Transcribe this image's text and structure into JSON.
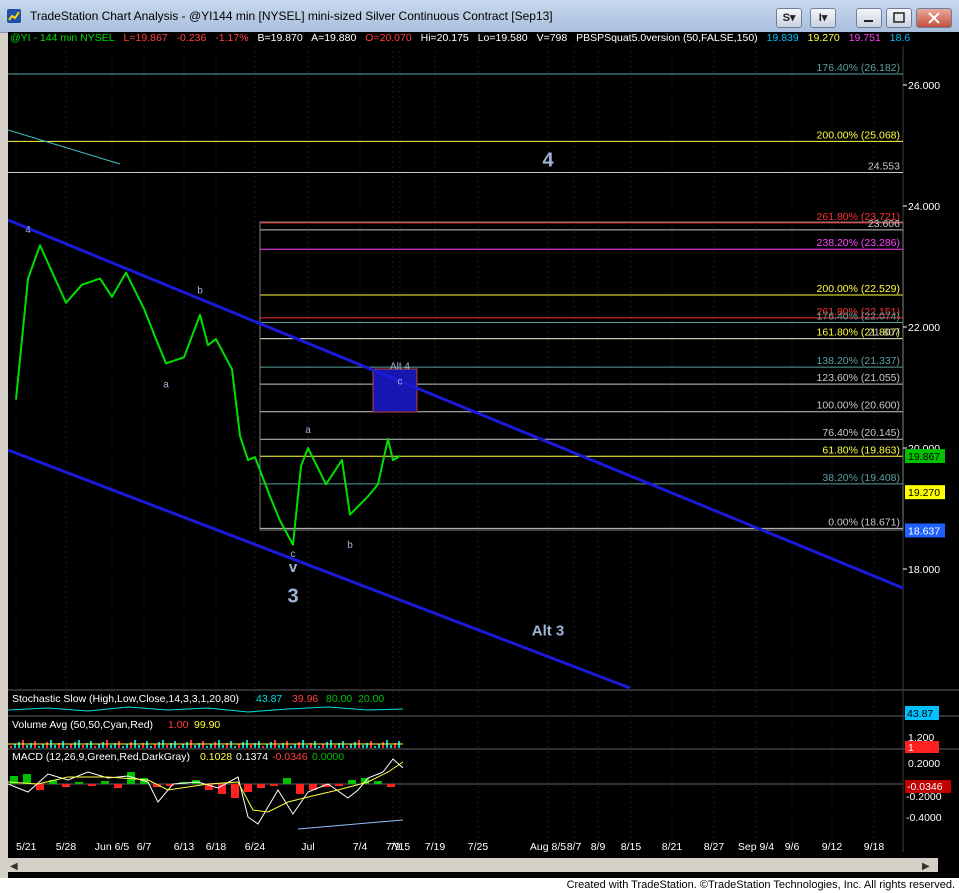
{
  "window": {
    "title": "TradeStation Chart Analysis - @YI144 min [NYSEL] mini-sized Silver Continuous Contract [Sep13]",
    "buttons": [
      "S",
      "I"
    ]
  },
  "infobar": {
    "symbol": "@YI - 144 min  NYSEL",
    "last": "L=19.867",
    "change": "-0.236",
    "change_pct": "-1.17%",
    "bid": "B=19.870",
    "ask": "A=19.880",
    "open": "O=20.070",
    "hi": "Hi=20.175",
    "lo": "Lo=19.580",
    "volume": "V=798",
    "study": "PBSPSquat5.0version (50,FALSE,150)",
    "study_vals": [
      "19.839",
      "19.270",
      "19.751",
      "18.6"
    ]
  },
  "colors": {
    "background": "#000000",
    "price": "#00e000",
    "channel": "#1a1ad8",
    "fib_line": "#c8c8c8",
    "red_line": "#ff3030",
    "magenta_line": "#ff40ff",
    "yellow_line": "#ffff40",
    "alt4_box": "#1616b0",
    "label_blue": "#9fb4d8"
  },
  "chart_data": {
    "type": "line",
    "title": "",
    "xlabel": "",
    "ylabel": "",
    "ylim": [
      16.8,
      26.8
    ],
    "yticks": [
      "26.000",
      "24.000",
      "22.000",
      "20.000",
      "18.000"
    ],
    "xticks": [
      "5/21",
      "5/28",
      "Jun 6/5",
      "6/7",
      "6/13",
      "6/18",
      "6/24",
      "Jul",
      "7/4",
      "7/9",
      "7/15",
      "7/19",
      "7/25",
      "Aug 8/5",
      "8/7",
      "8/9",
      "8/15",
      "8/21",
      "8/27",
      "Sep 9/4",
      "9/6",
      "9/12",
      "9/18"
    ],
    "price_series": [
      {
        "x": "5/21",
        "y": 20.8
      },
      {
        "x": "5/23",
        "y": 22.8
      },
      {
        "x": "5/25",
        "y": 23.35
      },
      {
        "x": "5/28",
        "y": 22.4
      },
      {
        "x": "5/30",
        "y": 22.7
      },
      {
        "x": "6/3",
        "y": 22.8
      },
      {
        "x": "6/5",
        "y": 22.5
      },
      {
        "x": "6/6",
        "y": 22.9
      },
      {
        "x": "6/7",
        "y": 22.3
      },
      {
        "x": "6/10",
        "y": 21.8
      },
      {
        "x": "6/11",
        "y": 21.4
      },
      {
        "x": "6/13",
        "y": 21.5
      },
      {
        "x": "6/14",
        "y": 22.2
      },
      {
        "x": "6/17",
        "y": 21.7
      },
      {
        "x": "6/18",
        "y": 21.8
      },
      {
        "x": "6/19",
        "y": 21.3
      },
      {
        "x": "6/20",
        "y": 20.2
      },
      {
        "x": "6/21",
        "y": 19.8
      },
      {
        "x": "6/24",
        "y": 19.85
      },
      {
        "x": "6/25",
        "y": 19.2
      },
      {
        "x": "6/26",
        "y": 18.8
      },
      {
        "x": "6/27",
        "y": 18.4
      },
      {
        "x": "6/28",
        "y": 19.7
      },
      {
        "x": "7/1",
        "y": 20.0
      },
      {
        "x": "7/2",
        "y": 19.4
      },
      {
        "x": "7/3",
        "y": 19.8
      },
      {
        "x": "7/5",
        "y": 18.9
      },
      {
        "x": "7/8",
        "y": 19.2
      },
      {
        "x": "7/9",
        "y": 19.4
      },
      {
        "x": "7/10",
        "y": 20.15
      },
      {
        "x": "7/11",
        "y": 19.8
      },
      {
        "x": "7/12",
        "y": 19.87
      }
    ],
    "fib_levels": [
      {
        "label": "176.40% (26.182)",
        "value": 26.182,
        "color": "#5aa0a0"
      },
      {
        "label": "200.00% (25.068)",
        "value": 25.068,
        "color": "#ffff40"
      },
      {
        "label": "24.553",
        "value": 24.553,
        "color": "#c8c8c8"
      },
      {
        "label": "261.80% (23.721)",
        "value": 23.721,
        "color": "#ff3030"
      },
      {
        "label": "23.606",
        "value": 23.606,
        "color": "#c8c8c8"
      },
      {
        "label": "238.20% (23.286)",
        "value": 23.286,
        "color": "#ff40ff"
      },
      {
        "label": "200.00% (22.529)",
        "value": 22.529,
        "color": "#ffff40"
      },
      {
        "label": "261.80% (22.151)",
        "value": 22.151,
        "color": "#ff3030"
      },
      {
        "label": "176.40% (22.074)",
        "value": 22.074,
        "color": "#5aa0a0"
      },
      {
        "label": "161.80% (21.807)",
        "value": 21.807,
        "color": "#ffff40"
      },
      {
        "label": "21.807",
        "value": 21.807,
        "color": "#c8c8c8"
      },
      {
        "label": "138.20% (21.337)",
        "value": 21.337,
        "color": "#5aa0a0"
      },
      {
        "label": "123.60% (21.055)",
        "value": 21.055,
        "color": "#c8c8c8"
      },
      {
        "label": "100.00% (20.600)",
        "value": 20.6,
        "color": "#c8c8c8"
      },
      {
        "label": "76.40% (20.145)",
        "value": 20.145,
        "color": "#c8c8c8"
      },
      {
        "label": "61.80% (19.863)",
        "value": 19.863,
        "color": "#ffff40"
      },
      {
        "label": "38.20% (19.408)",
        "value": 19.408,
        "color": "#5aa0a0"
      },
      {
        "label": "0.00% (18.671)",
        "value": 18.671,
        "color": "#c8c8c8"
      }
    ],
    "axis_badges": [
      {
        "label": "19.867",
        "value": 19.867,
        "bg": "#00c000",
        "fg": "#000000"
      },
      {
        "label": "19.270",
        "value": 19.27,
        "bg": "#ffff00",
        "fg": "#000000"
      },
      {
        "label": "18.637",
        "value": 18.637,
        "bg": "#2060ff",
        "fg": "#ffffff"
      }
    ],
    "wave_labels": [
      {
        "text": "4",
        "x": "5/23",
        "y": 23.55,
        "size": "small"
      },
      {
        "text": "b",
        "x": "6/14",
        "y": 22.55,
        "size": "small"
      },
      {
        "text": "a",
        "x": "6/11",
        "y": 21.0,
        "size": "small"
      },
      {
        "text": "a",
        "x": "7/1",
        "y": 20.25,
        "size": "small"
      },
      {
        "text": "c",
        "x": "6/27",
        "y": 18.2,
        "size": "small"
      },
      {
        "text": "v",
        "x": "6/27",
        "y": 17.95,
        "size": "medium"
      },
      {
        "text": "3",
        "x": "6/27",
        "y": 17.45,
        "size": "large"
      },
      {
        "text": "b",
        "x": "7/5",
        "y": 18.35,
        "size": "small"
      },
      {
        "text": "c",
        "x": "7/15",
        "y": 21.05,
        "size": "small"
      },
      {
        "text": "Alt 4",
        "x": "7/12",
        "y": 21.3,
        "size": "small"
      },
      {
        "text": "4",
        "x": "8/5",
        "y": 24.65,
        "size": "large"
      },
      {
        "text": "Alt 3",
        "x": "8/5",
        "y": 16.9,
        "size": "medium"
      }
    ],
    "subpanels": {
      "stochastic": {
        "label": "Stochastic Slow (High,Low,Close,14,3,3,1,20,80)",
        "values": [
          "43.87",
          "39.96",
          "80.00",
          "20.00"
        ],
        "badge": "43.87"
      },
      "volume": {
        "label": "Volume Avg (50,50,Cyan,Red)",
        "values": [
          "1.00",
          "99.90"
        ],
        "axis_labels": [
          "1.200",
          "1"
        ]
      },
      "macd": {
        "label": "MACD (12,26,9,Green,Red,DarkGray)",
        "values": [
          "0.1028",
          "0.1374",
          "-0.0346",
          "0.0000"
        ],
        "axis_labels": [
          "0.2000",
          "-0.2000",
          "-0.4000"
        ],
        "badges": [
          "-0.0346"
        ]
      }
    }
  },
  "footer": {
    "text": "Created with TradeStation. ©TradeStation Technologies, Inc. All rights reserved."
  }
}
